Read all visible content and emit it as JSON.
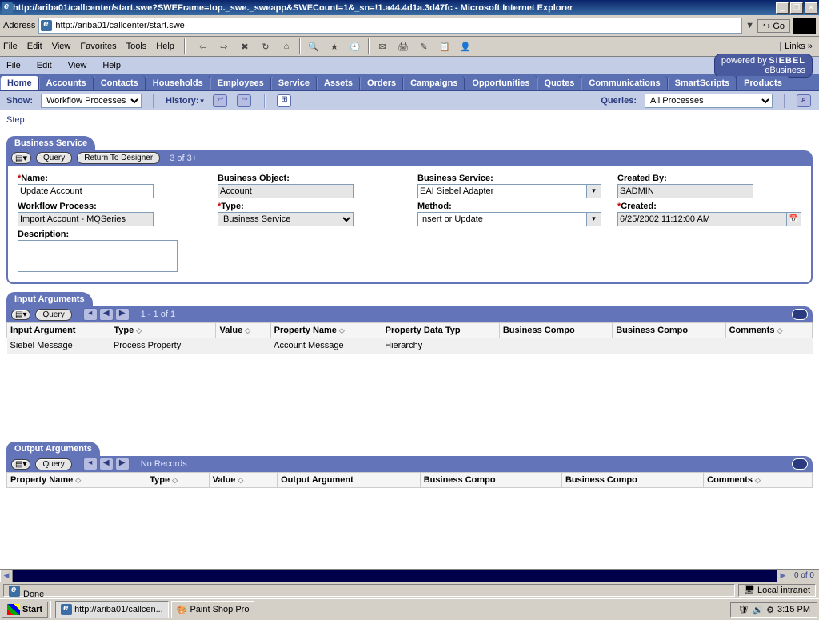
{
  "window": {
    "title": "http://ariba01/callcenter/start.swe?SWEFrame=top._swe._sweapp&SWECount=1&_sn=!1.a44.4d1a.3d47fc - Microsoft Internet Explorer",
    "address_label": "Address",
    "url": "http://ariba01/callcenter/start.swe",
    "go": "Go",
    "links": "Links"
  },
  "ie_menu": [
    "File",
    "Edit",
    "View",
    "Favorites",
    "Tools",
    "Help"
  ],
  "siebel_menu": [
    "File",
    "Edit",
    "View",
    "Help"
  ],
  "siebel_logo": {
    "prefix": "powered by",
    "brand": "SIEBEL",
    "suffix": "eBusiness"
  },
  "screen_tabs": [
    "Home",
    "Accounts",
    "Contacts",
    "Households",
    "Employees",
    "Service",
    "Assets",
    "Orders",
    "Campaigns",
    "Opportunities",
    "Quotes",
    "Communications",
    "SmartScripts",
    "Products"
  ],
  "viewbar": {
    "show_label": "Show:",
    "show_value": "Workflow Processes",
    "history_label": "History:",
    "queries_label": "Queries:",
    "queries_value": "All Processes"
  },
  "step_label": "Step:",
  "applets": {
    "business_service": {
      "title": "Business Service",
      "menu_btn": "▾",
      "query_btn": "Query",
      "return_btn": "Return To Designer",
      "rec": "3 of 3+",
      "fields": {
        "name": {
          "label": "Name:",
          "value": "Update Account",
          "required": true
        },
        "workflow_process": {
          "label": "Workflow Process:",
          "value": "Import Account - MQSeries"
        },
        "description": {
          "label": "Description:",
          "value": ""
        },
        "business_object": {
          "label": "Business Object:",
          "value": "Account"
        },
        "type": {
          "label": "Type:",
          "value": "Business Service",
          "required": true
        },
        "business_service": {
          "label": "Business Service:",
          "value": "EAI Siebel Adapter"
        },
        "method": {
          "label": "Method:",
          "value": "Insert or Update"
        },
        "created_by": {
          "label": "Created By:",
          "value": "SADMIN"
        },
        "created": {
          "label": "Created:",
          "value": "6/25/2002 11:12:00 AM",
          "required": true
        }
      }
    },
    "input_args": {
      "title": "Input Arguments",
      "query_btn": "Query",
      "rec": "1 - 1 of 1",
      "columns": [
        "Input Argument",
        "Type",
        "Value",
        "Property Name",
        "Property Data Typ",
        "Business Compo",
        "Business Compo",
        "Comments"
      ],
      "rows": [
        {
          "c0": "Siebel Message",
          "c1": "Process Property",
          "c2": "",
          "c3": "Account Message",
          "c4": "Hierarchy",
          "c5": "",
          "c6": "",
          "c7": ""
        }
      ]
    },
    "output_args": {
      "title": "Output Arguments",
      "query_btn": "Query",
      "rec": "No Records",
      "columns": [
        "Property Name",
        "Type",
        "Value",
        "Output Argument",
        "Business Compo",
        "Business Compo",
        "Comments"
      ]
    }
  },
  "footer_counter": "0 of 0",
  "statusbar": {
    "done": "Done",
    "zone": "Local intranet"
  },
  "taskbar": {
    "start": "Start",
    "tasks": [
      "http://ariba01/callcen...",
      "Paint Shop Pro"
    ],
    "clock": "3:15 PM"
  }
}
